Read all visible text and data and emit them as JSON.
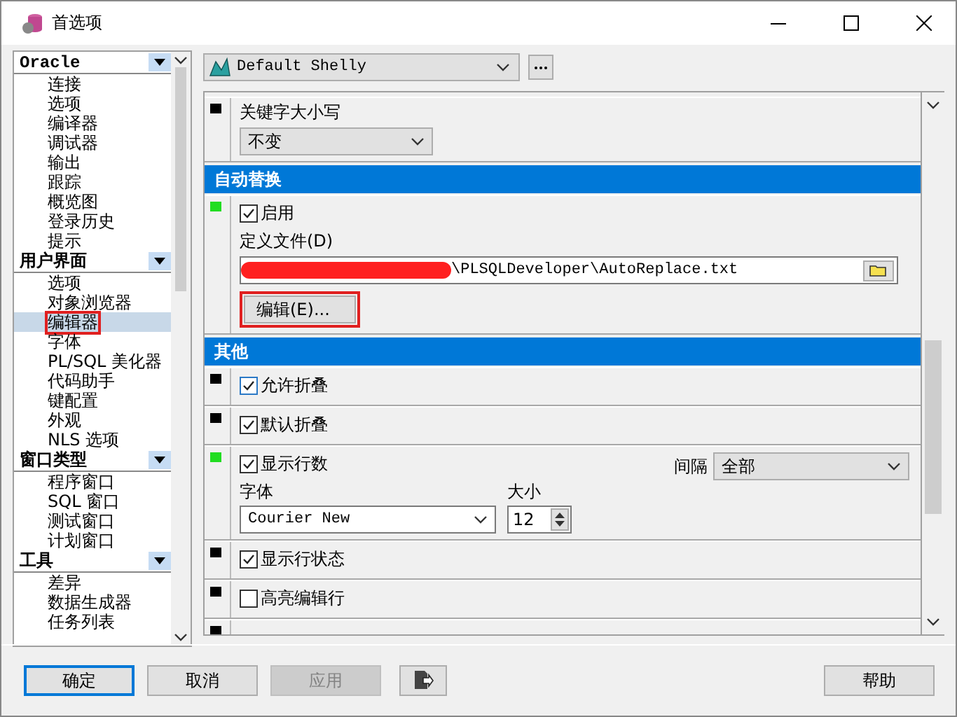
{
  "window": {
    "title": "首选项"
  },
  "sidebar": {
    "groups": [
      {
        "label": "Oracle",
        "items": [
          {
            "label": "连接",
            "selected": false,
            "marked": false
          },
          {
            "label": "选项",
            "selected": false,
            "marked": false
          },
          {
            "label": "编译器",
            "selected": false,
            "marked": false
          },
          {
            "label": "调试器",
            "selected": false,
            "marked": false
          },
          {
            "label": "输出",
            "selected": false,
            "marked": false
          },
          {
            "label": "跟踪",
            "selected": false,
            "marked": false
          },
          {
            "label": "概览图",
            "selected": false,
            "marked": false
          },
          {
            "label": "登录历史",
            "selected": false,
            "marked": false
          },
          {
            "label": "提示",
            "selected": false,
            "marked": false
          }
        ]
      },
      {
        "label": "用户界面",
        "items": [
          {
            "label": "选项",
            "selected": false,
            "marked": false
          },
          {
            "label": "对象浏览器",
            "selected": false,
            "marked": false
          },
          {
            "label": "编辑器",
            "selected": true,
            "marked": true
          },
          {
            "label": "字体",
            "selected": false,
            "marked": false
          },
          {
            "label": "PL/SQL 美化器",
            "selected": false,
            "marked": false
          },
          {
            "label": "代码助手",
            "selected": false,
            "marked": false
          },
          {
            "label": "键配置",
            "selected": false,
            "marked": false
          },
          {
            "label": "外观",
            "selected": false,
            "marked": false
          },
          {
            "label": "NLS 选项",
            "selected": false,
            "marked": false
          }
        ]
      },
      {
        "label": "窗口类型",
        "items": [
          {
            "label": "程序窗口",
            "selected": false,
            "marked": false
          },
          {
            "label": "SQL 窗口",
            "selected": false,
            "marked": false
          },
          {
            "label": "测试窗口",
            "selected": false,
            "marked": false
          },
          {
            "label": "计划窗口",
            "selected": false,
            "marked": false
          }
        ]
      },
      {
        "label": "工具",
        "items": [
          {
            "label": "差异",
            "selected": false,
            "marked": false
          },
          {
            "label": "数据生成器",
            "selected": false,
            "marked": false
          },
          {
            "label": "任务列表",
            "selected": false,
            "marked": false
          }
        ]
      }
    ]
  },
  "profile": {
    "value": "Default Shelly"
  },
  "rows": [
    {
      "kind": "select",
      "color": "#000000",
      "label": "关键字大小写",
      "value": "不变"
    },
    {
      "kind": "header",
      "label": "自动替换"
    },
    {
      "kind": "file",
      "color": "#22dd22",
      "checkbox": {
        "label": "启用",
        "checked": true
      },
      "label": "定义文件(D)",
      "value": "\\PLSQLDeveloper\\AutoReplace.txt",
      "redacted": true,
      "button": {
        "label": "编辑(E)...",
        "marked": true
      }
    },
    {
      "kind": "header",
      "label": "其他"
    },
    {
      "kind": "check",
      "color": "#000000",
      "label": "允许折叠",
      "checked": true
    },
    {
      "kind": "check",
      "color": "#000000",
      "label": "默认折叠",
      "checked": true
    },
    {
      "kind": "linenumbers",
      "color": "#22dd22",
      "label": "显示行数",
      "checked": true,
      "interval_label": "间隔",
      "interval": "全部",
      "font_label": "字体",
      "font": "Courier New",
      "size_label": "大小",
      "size": "12"
    },
    {
      "kind": "check",
      "color": "#000000",
      "label": "显示行状态",
      "checked": true
    },
    {
      "kind": "check",
      "color": "#000000",
      "label": "高亮编辑行",
      "checked": false
    },
    {
      "kind": "cut",
      "color": "#000000"
    }
  ],
  "buttons": [
    {
      "label": "确定",
      "kind": "default",
      "disabled": false
    },
    {
      "label": "取消",
      "kind": "normal",
      "disabled": false
    },
    {
      "label": "应用",
      "kind": "normal",
      "disabled": true
    },
    {
      "kind": "icon",
      "disabled": false
    },
    {
      "label": "帮助",
      "kind": "normal",
      "disabled": false
    }
  ]
}
